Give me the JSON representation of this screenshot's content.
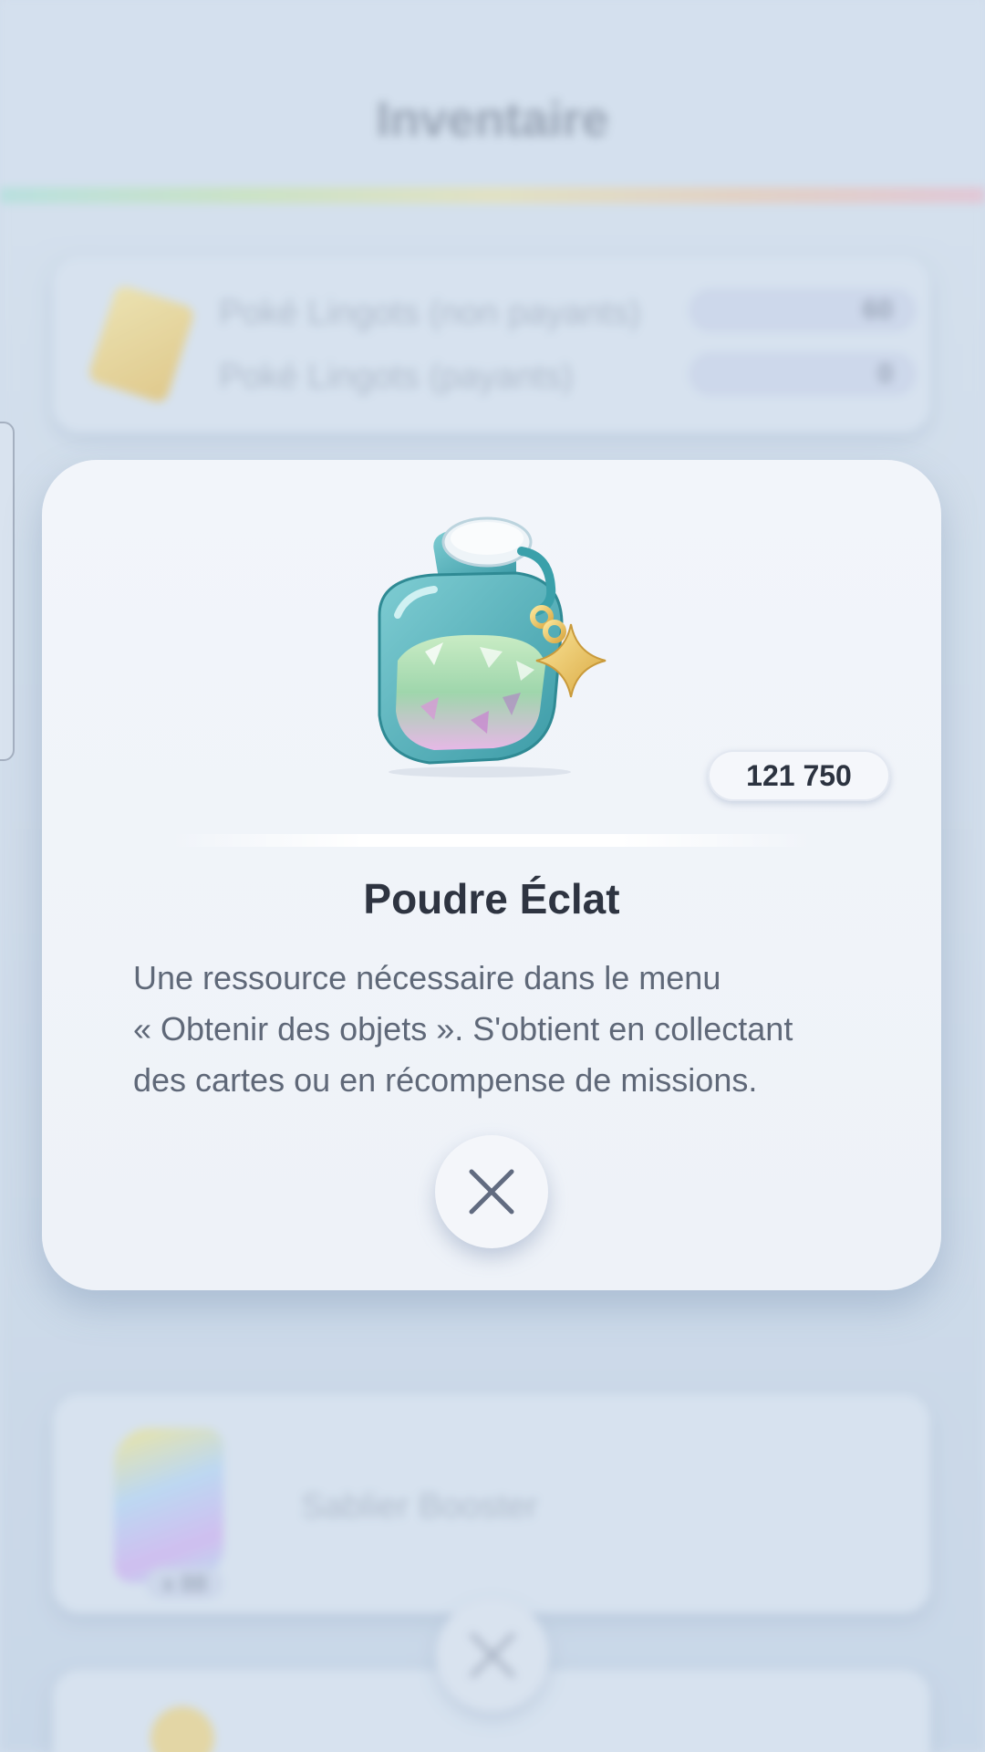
{
  "background": {
    "title": "Inventaire",
    "rows": [
      {
        "label": "Poké Lingots (non payants)",
        "value": "60"
      },
      {
        "label": "Poké Lingots (payants)",
        "value": "0"
      }
    ],
    "booster_label": "Sablier Booster",
    "booster_count": "x 88"
  },
  "item": {
    "name": "Poudre Éclat",
    "count": "121 750",
    "description": "Une ressource nécessaire dans le menu\n« Obtenir des objets ». S'obtient en collectant\ndes cartes ou en récompense de missions."
  },
  "icons": {
    "close": "close-icon",
    "item": "dust-bottle-icon"
  },
  "colors": {
    "title_text": "#2e3441",
    "body_text": "#5f6878",
    "modal_bg": "#f2f5fa"
  }
}
